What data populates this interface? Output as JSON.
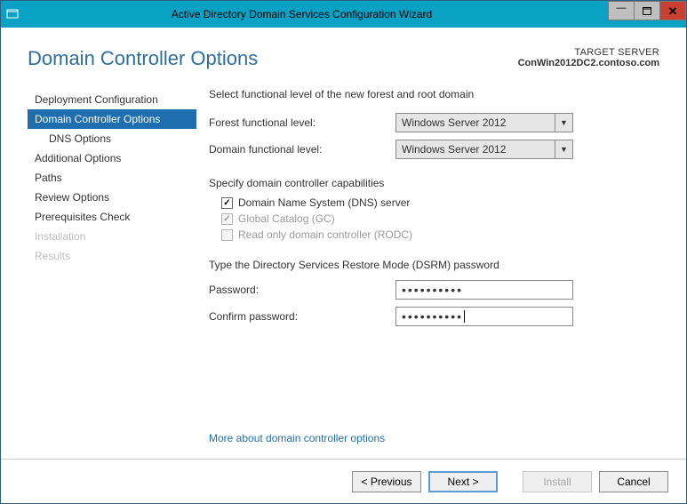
{
  "window": {
    "title": "Active Directory Domain Services Configuration Wizard"
  },
  "header": {
    "page_title": "Domain Controller Options",
    "target_label": "TARGET SERVER",
    "target_value": "ConWin2012DC2.contoso.com"
  },
  "sidebar": {
    "items": [
      {
        "label": "Deployment Configuration",
        "state": "normal"
      },
      {
        "label": "Domain Controller Options",
        "state": "selected"
      },
      {
        "label": "DNS Options",
        "state": "sub"
      },
      {
        "label": "Additional Options",
        "state": "normal"
      },
      {
        "label": "Paths",
        "state": "normal"
      },
      {
        "label": "Review Options",
        "state": "normal"
      },
      {
        "label": "Prerequisites Check",
        "state": "normal"
      },
      {
        "label": "Installation",
        "state": "disabled"
      },
      {
        "label": "Results",
        "state": "disabled"
      }
    ]
  },
  "main": {
    "func_level_intro": "Select functional level of the new forest and root domain",
    "forest_label": "Forest functional level:",
    "forest_value": "Windows Server 2012",
    "domain_label": "Domain functional level:",
    "domain_value": "Windows Server 2012",
    "caps_heading": "Specify domain controller capabilities",
    "cap_dns": "Domain Name System (DNS) server",
    "cap_gc": "Global Catalog (GC)",
    "cap_rodc": "Read only domain controller (RODC)",
    "dsrm_heading": "Type the Directory Services Restore Mode (DSRM) password",
    "pw_label": "Password:",
    "pw_value": "••••••••••",
    "confirm_label": "Confirm password:",
    "confirm_value": "••••••••••",
    "more_link": "More about domain controller options"
  },
  "footer": {
    "previous": "< Previous",
    "next": "Next >",
    "install": "Install",
    "cancel": "Cancel"
  }
}
